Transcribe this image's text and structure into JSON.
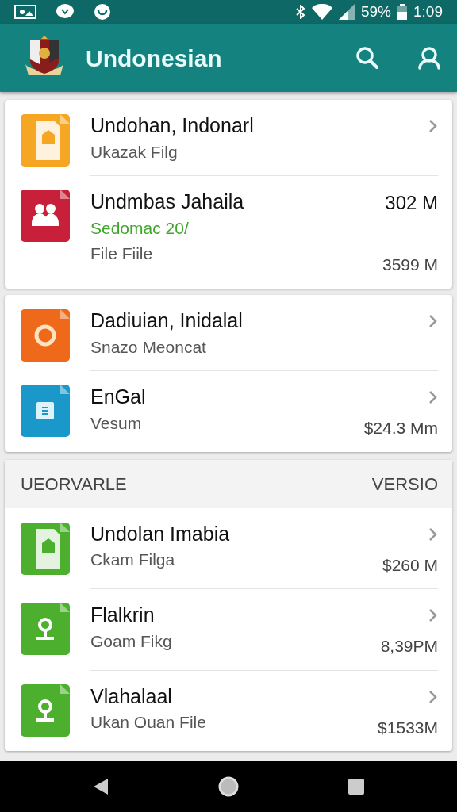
{
  "status_bar": {
    "battery_text": "59%",
    "time": "1:09"
  },
  "app_bar": {
    "title": "Undonesian"
  },
  "cards": [
    {
      "items": [
        {
          "kind": "document",
          "color": "#f5a623",
          "title": "Undohan, Indonarl",
          "lines": [
            {
              "text": "Ukazak Filg",
              "accent": false
            }
          ],
          "chevron": true
        },
        {
          "kind": "people",
          "color": "#c8203a",
          "title": "Undmbas Jahaila",
          "lines": [
            {
              "text": "Sedomac 20/",
              "accent": true
            },
            {
              "text": "File Fiile",
              "accent": false
            }
          ],
          "sizes": [
            "302 M",
            "3599 M"
          ],
          "chevron": false
        }
      ]
    },
    {
      "items": [
        {
          "kind": "ring",
          "color": "#ee6a1a",
          "title": "Dadiuian, Inidalal",
          "lines": [
            {
              "text": "Snazo Meoncat",
              "accent": false
            }
          ],
          "chevron": true
        },
        {
          "kind": "list",
          "color": "#1a98c9",
          "title": "EnGal",
          "lines": [
            {
              "text": "Vesum",
              "accent": false
            }
          ],
          "sizes": [
            "$24.3 Mm"
          ],
          "chevron": true
        }
      ]
    }
  ],
  "section": {
    "title": "UEORVARLE",
    "action": "VERSIO",
    "items": [
      {
        "kind": "document",
        "color": "#4caf2d",
        "title": "Undolan Imabia",
        "lines": [
          {
            "text": "Ckam Filga",
            "accent": false
          }
        ],
        "sizes": [
          "$260 M"
        ],
        "chevron": true
      },
      {
        "kind": "pin",
        "color": "#4caf2d",
        "title": "Flalkrin",
        "lines": [
          {
            "text": "Goam Fikg",
            "accent": false
          }
        ],
        "sizes": [
          "8,39PM"
        ],
        "chevron": true
      },
      {
        "kind": "pin",
        "color": "#4caf2d",
        "title": "Vlahalaal",
        "lines": [
          {
            "text": "Ukan Ouan File",
            "accent": false
          }
        ],
        "sizes": [
          "$1533M"
        ],
        "chevron": true
      }
    ]
  }
}
